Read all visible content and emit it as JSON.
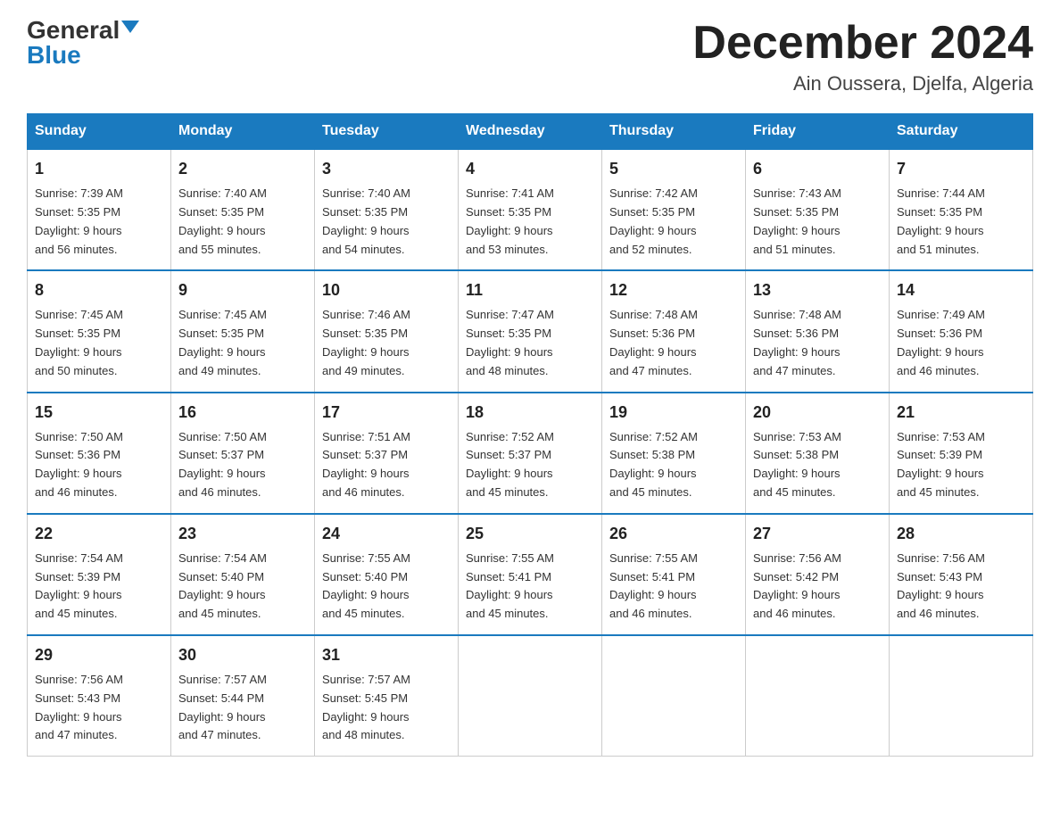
{
  "header": {
    "logo_general": "General",
    "logo_blue": "Blue",
    "title": "December 2024",
    "subtitle": "Ain Oussera, Djelfa, Algeria"
  },
  "weekdays": [
    "Sunday",
    "Monday",
    "Tuesday",
    "Wednesday",
    "Thursday",
    "Friday",
    "Saturday"
  ],
  "weeks": [
    [
      {
        "day": "1",
        "sunrise": "7:39 AM",
        "sunset": "5:35 PM",
        "daylight": "9 hours and 56 minutes."
      },
      {
        "day": "2",
        "sunrise": "7:40 AM",
        "sunset": "5:35 PM",
        "daylight": "9 hours and 55 minutes."
      },
      {
        "day": "3",
        "sunrise": "7:40 AM",
        "sunset": "5:35 PM",
        "daylight": "9 hours and 54 minutes."
      },
      {
        "day": "4",
        "sunrise": "7:41 AM",
        "sunset": "5:35 PM",
        "daylight": "9 hours and 53 minutes."
      },
      {
        "day": "5",
        "sunrise": "7:42 AM",
        "sunset": "5:35 PM",
        "daylight": "9 hours and 52 minutes."
      },
      {
        "day": "6",
        "sunrise": "7:43 AM",
        "sunset": "5:35 PM",
        "daylight": "9 hours and 51 minutes."
      },
      {
        "day": "7",
        "sunrise": "7:44 AM",
        "sunset": "5:35 PM",
        "daylight": "9 hours and 51 minutes."
      }
    ],
    [
      {
        "day": "8",
        "sunrise": "7:45 AM",
        "sunset": "5:35 PM",
        "daylight": "9 hours and 50 minutes."
      },
      {
        "day": "9",
        "sunrise": "7:45 AM",
        "sunset": "5:35 PM",
        "daylight": "9 hours and 49 minutes."
      },
      {
        "day": "10",
        "sunrise": "7:46 AM",
        "sunset": "5:35 PM",
        "daylight": "9 hours and 49 minutes."
      },
      {
        "day": "11",
        "sunrise": "7:47 AM",
        "sunset": "5:35 PM",
        "daylight": "9 hours and 48 minutes."
      },
      {
        "day": "12",
        "sunrise": "7:48 AM",
        "sunset": "5:36 PM",
        "daylight": "9 hours and 47 minutes."
      },
      {
        "day": "13",
        "sunrise": "7:48 AM",
        "sunset": "5:36 PM",
        "daylight": "9 hours and 47 minutes."
      },
      {
        "day": "14",
        "sunrise": "7:49 AM",
        "sunset": "5:36 PM",
        "daylight": "9 hours and 46 minutes."
      }
    ],
    [
      {
        "day": "15",
        "sunrise": "7:50 AM",
        "sunset": "5:36 PM",
        "daylight": "9 hours and 46 minutes."
      },
      {
        "day": "16",
        "sunrise": "7:50 AM",
        "sunset": "5:37 PM",
        "daylight": "9 hours and 46 minutes."
      },
      {
        "day": "17",
        "sunrise": "7:51 AM",
        "sunset": "5:37 PM",
        "daylight": "9 hours and 46 minutes."
      },
      {
        "day": "18",
        "sunrise": "7:52 AM",
        "sunset": "5:37 PM",
        "daylight": "9 hours and 45 minutes."
      },
      {
        "day": "19",
        "sunrise": "7:52 AM",
        "sunset": "5:38 PM",
        "daylight": "9 hours and 45 minutes."
      },
      {
        "day": "20",
        "sunrise": "7:53 AM",
        "sunset": "5:38 PM",
        "daylight": "9 hours and 45 minutes."
      },
      {
        "day": "21",
        "sunrise": "7:53 AM",
        "sunset": "5:39 PM",
        "daylight": "9 hours and 45 minutes."
      }
    ],
    [
      {
        "day": "22",
        "sunrise": "7:54 AM",
        "sunset": "5:39 PM",
        "daylight": "9 hours and 45 minutes."
      },
      {
        "day": "23",
        "sunrise": "7:54 AM",
        "sunset": "5:40 PM",
        "daylight": "9 hours and 45 minutes."
      },
      {
        "day": "24",
        "sunrise": "7:55 AM",
        "sunset": "5:40 PM",
        "daylight": "9 hours and 45 minutes."
      },
      {
        "day": "25",
        "sunrise": "7:55 AM",
        "sunset": "5:41 PM",
        "daylight": "9 hours and 45 minutes."
      },
      {
        "day": "26",
        "sunrise": "7:55 AM",
        "sunset": "5:41 PM",
        "daylight": "9 hours and 46 minutes."
      },
      {
        "day": "27",
        "sunrise": "7:56 AM",
        "sunset": "5:42 PM",
        "daylight": "9 hours and 46 minutes."
      },
      {
        "day": "28",
        "sunrise": "7:56 AM",
        "sunset": "5:43 PM",
        "daylight": "9 hours and 46 minutes."
      }
    ],
    [
      {
        "day": "29",
        "sunrise": "7:56 AM",
        "sunset": "5:43 PM",
        "daylight": "9 hours and 47 minutes."
      },
      {
        "day": "30",
        "sunrise": "7:57 AM",
        "sunset": "5:44 PM",
        "daylight": "9 hours and 47 minutes."
      },
      {
        "day": "31",
        "sunrise": "7:57 AM",
        "sunset": "5:45 PM",
        "daylight": "9 hours and 48 minutes."
      },
      null,
      null,
      null,
      null
    ]
  ],
  "labels": {
    "sunrise": "Sunrise:",
    "sunset": "Sunset:",
    "daylight": "Daylight:"
  }
}
